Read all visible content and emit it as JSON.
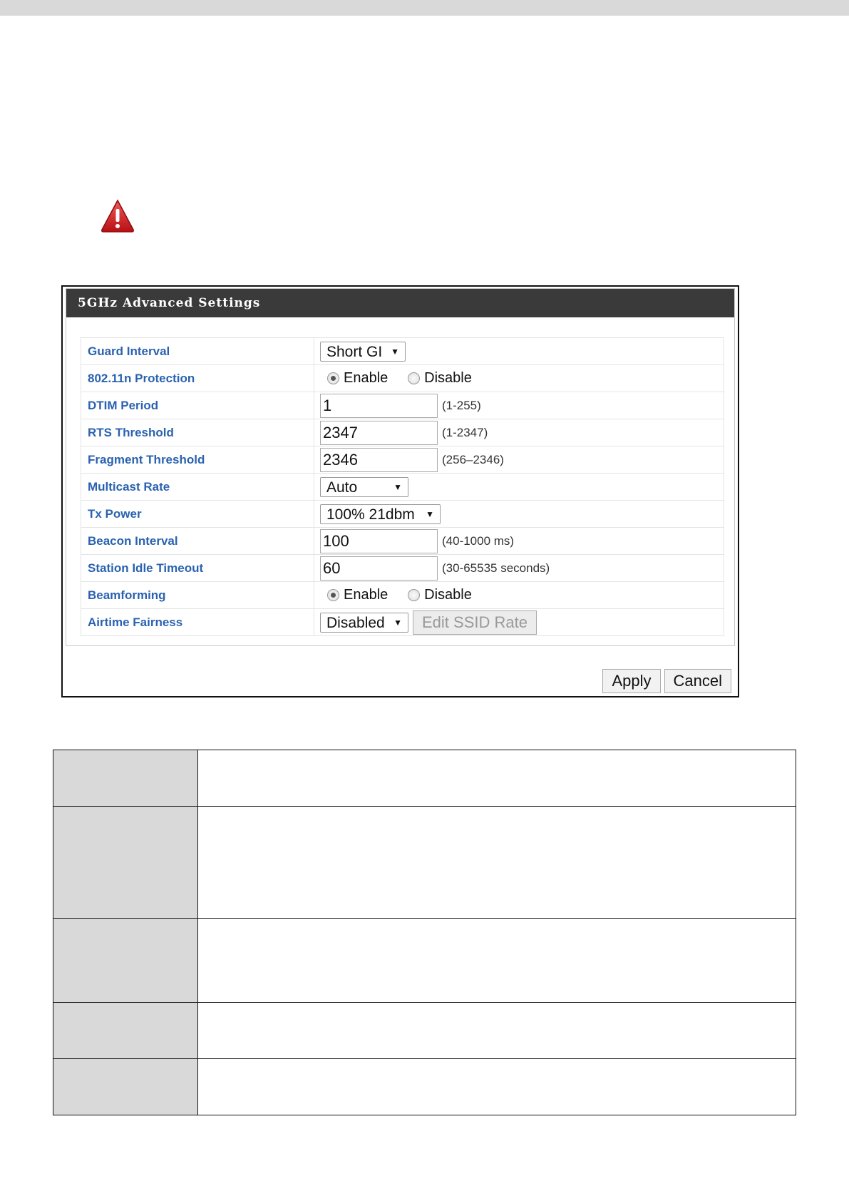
{
  "panel": {
    "title": "5GHz Advanced Settings",
    "rows": [
      {
        "label": "Guard Interval",
        "select": "Short GI"
      },
      {
        "label": "802.11n Protection",
        "radio": {
          "enable": "Enable",
          "disable": "Disable",
          "selected": "Enable"
        }
      },
      {
        "label": "DTIM Period",
        "value": "1",
        "hint": "(1-255)"
      },
      {
        "label": "RTS Threshold",
        "value": "2347",
        "hint": "(1-2347)"
      },
      {
        "label": "Fragment Threshold",
        "value": "2346",
        "hint": "(256–2346)"
      },
      {
        "label": "Multicast Rate",
        "select": "Auto"
      },
      {
        "label": "Tx Power",
        "select": "100% 21dbm"
      },
      {
        "label": "Beacon Interval",
        "value": "100",
        "hint": "(40-1000 ms)"
      },
      {
        "label": "Station Idle Timeout",
        "value": "60",
        "hint": "(30-65535 seconds)"
      },
      {
        "label": "Beamforming",
        "radio": {
          "enable": "Enable",
          "disable": "Disable",
          "selected": "Enable"
        }
      },
      {
        "label": "Airtime Fairness",
        "select": "Disabled",
        "button": "Edit SSID Rate"
      }
    ],
    "apply_label": "Apply",
    "cancel_label": "Cancel",
    "dropdown_arrow": "▼",
    "header_color": "#3a3a3a",
    "label_color": "#2a62b0"
  },
  "icons": {
    "warning": "warning-icon"
  }
}
